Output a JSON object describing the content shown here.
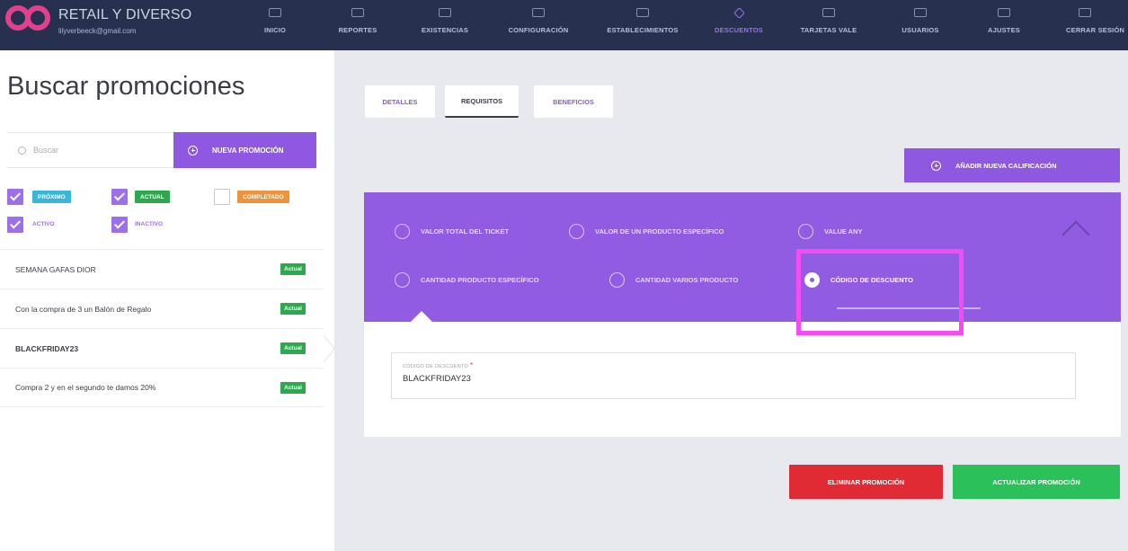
{
  "header": {
    "brand_name": "RETAIL Y DIVERSO",
    "brand_email": "lilyverbeeck@gmail.com",
    "nav": [
      {
        "label": "INICIO",
        "icon": "home-icon"
      },
      {
        "label": "REPORTES",
        "icon": "chart-icon"
      },
      {
        "label": "EXISTENCIAS",
        "icon": "boxes-icon"
      },
      {
        "label": "CONFIGURACIÓN",
        "icon": "gear-icon"
      },
      {
        "label": "ESTABLECIMIENTOS",
        "icon": "store-icon"
      },
      {
        "label": "DESCUENTOS",
        "icon": "tag-icon"
      },
      {
        "label": "TARJETAS VALE",
        "icon": "card-icon"
      },
      {
        "label": "USUARIOS",
        "icon": "users-icon"
      },
      {
        "label": "AJUSTES",
        "icon": "sliders-icon"
      },
      {
        "label": "CERRAR SESIÓN",
        "icon": "logout-icon"
      }
    ],
    "active_nav": "DESCUENTOS"
  },
  "left": {
    "title": "Buscar promociones",
    "search_placeholder": "Buscar",
    "new_promo_label": "NUEVA PROMOCIÓN",
    "filters": [
      {
        "label": "PRÓXIMO",
        "checked": true,
        "color": "#3ab6d8"
      },
      {
        "label": "ACTUAL",
        "checked": true,
        "color": "#2ea84f"
      },
      {
        "label": "COMPLETADO",
        "checked": false,
        "color": "#f0923a"
      },
      {
        "label": "ACTIVO",
        "checked": true
      },
      {
        "label": "INACTIVO",
        "checked": true
      }
    ],
    "promotions": [
      {
        "name": "SEMANA GAFAS DIOR",
        "status": "Actual"
      },
      {
        "name": "Con la compra de 3 un Balón de Regalo",
        "status": "Actual"
      },
      {
        "name": "BLACKFRIDAY23",
        "status": "Actual",
        "selected": true
      },
      {
        "name": "Compra 2 y en el segundo te damos 20%",
        "status": "Actual"
      }
    ]
  },
  "right": {
    "tabs": [
      "DETALLES",
      "REQUISITOS",
      "BENEFICIOS"
    ],
    "active_tab": "REQUISITOS",
    "add_qualification_label": "AÑADIR NUEVA CALIFICACIÓN",
    "options": [
      {
        "label": "VALOR TOTAL DEL TICKET",
        "selected": false
      },
      {
        "label": "VALOR DE UN PRODUCTO ESPECÍFICO",
        "selected": false
      },
      {
        "label": "VALUE ANY",
        "selected": false
      },
      {
        "label": "CANTIDAD PRODUCTO ESPECÍFICO",
        "selected": false
      },
      {
        "label": "CANTIDAD VARIOS PRODUCTO",
        "selected": false
      },
      {
        "label": "CÓDIGO DE DESCUENTO",
        "selected": true
      }
    ],
    "code_field": {
      "label": "CÓDIGO DE DESCUENTO",
      "required_mark": "*",
      "value": "BLACKFRIDAY23"
    },
    "delete_label": "ELIMINAR PROMOCIÓN",
    "update_label": "ACTUALIZAR PROMOCIÓN"
  },
  "colors": {
    "nav_bg": "#283050",
    "accent": "#8f58e0",
    "panel_purple": "#925ce2",
    "danger": "#e02b35",
    "success": "#2bc05a",
    "highlight": "#f44cf0"
  }
}
